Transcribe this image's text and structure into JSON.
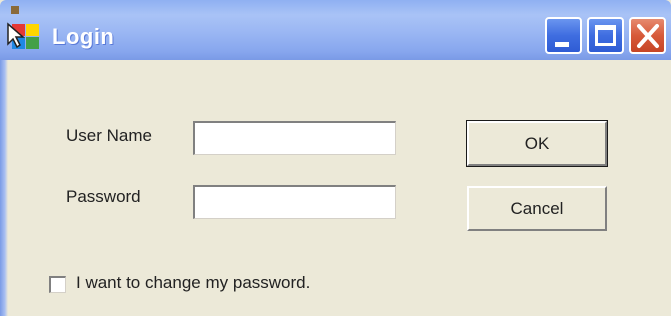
{
  "window": {
    "title": "Login",
    "controls": {
      "minimize_icon": "minimize-icon",
      "maximize_icon": "maximize-icon",
      "close_icon": "close-icon"
    }
  },
  "form": {
    "username": {
      "label": "User Name",
      "value": "",
      "placeholder": ""
    },
    "password": {
      "label": "Password",
      "value": "",
      "placeholder": ""
    },
    "ok_label": "OK",
    "cancel_label": "Cancel",
    "change_password": {
      "label": "I want to change my password.",
      "checked": false
    }
  },
  "colors": {
    "titlebar": "#8fb0f2",
    "window_bg": "#ece9d8",
    "close_button": "#d75a3a",
    "button_blue": "#3f6de0"
  }
}
